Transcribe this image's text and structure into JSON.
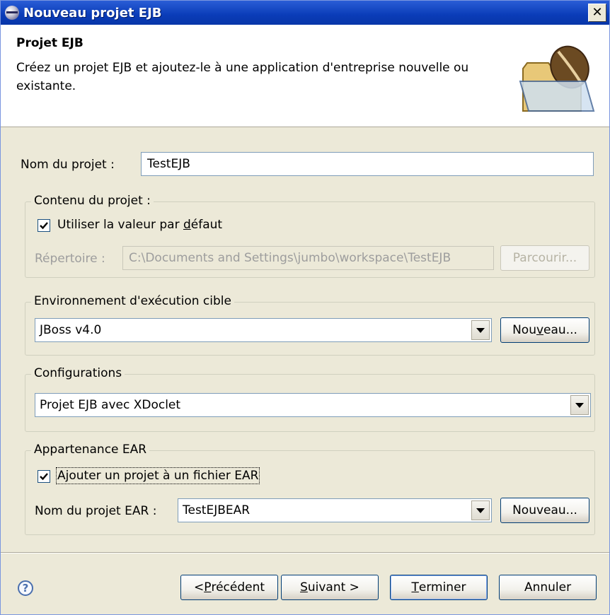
{
  "window": {
    "title": "Nouveau projet EJB",
    "close_label": "✕"
  },
  "header": {
    "title": "Projet EJB",
    "description": "Créez un projet EJB et ajoutez-le à une application d'entreprise nouvelle ou existante.",
    "icon": "folder-with-bean-icon"
  },
  "project_name": {
    "label": "Nom du projet :",
    "value": "TestEJB"
  },
  "project_contents": {
    "title": "Contenu du projet :",
    "use_default": {
      "label_pre": "Utiliser la valeur par ",
      "label_mnemonic": "d",
      "label_post": "éfaut",
      "checked": true
    },
    "directory_label": "Répertoire :",
    "directory_value": "C:\\Documents and Settings\\jumbo\\workspace\\TestEJB",
    "browse_label": "Parcourir..."
  },
  "target_runtime": {
    "title": "Environnement d'exécution cible",
    "selected": "JBoss v4.0",
    "new_pre": "Nou",
    "new_mnemonic": "v",
    "new_post": "eau..."
  },
  "configurations": {
    "title": "Configurations",
    "selected": "Projet EJB avec XDoclet"
  },
  "ear_membership": {
    "title": "Appartenance EAR",
    "add_to_ear": {
      "label": "Ajouter un projet à un fichier EAR",
      "checked": true
    },
    "ear_name_label": "Nom du projet EAR :",
    "ear_name_value": "TestEJBEAR",
    "new_label": "Nouveau..."
  },
  "footer": {
    "help_label": "?",
    "back_pre": "< ",
    "back_mnemonic": "P",
    "back_post": "récédent",
    "next_mnemonic": "S",
    "next_post": "uivant >",
    "finish_mnemonic": "T",
    "finish_post": "erminer",
    "cancel_label": "Annuler"
  }
}
